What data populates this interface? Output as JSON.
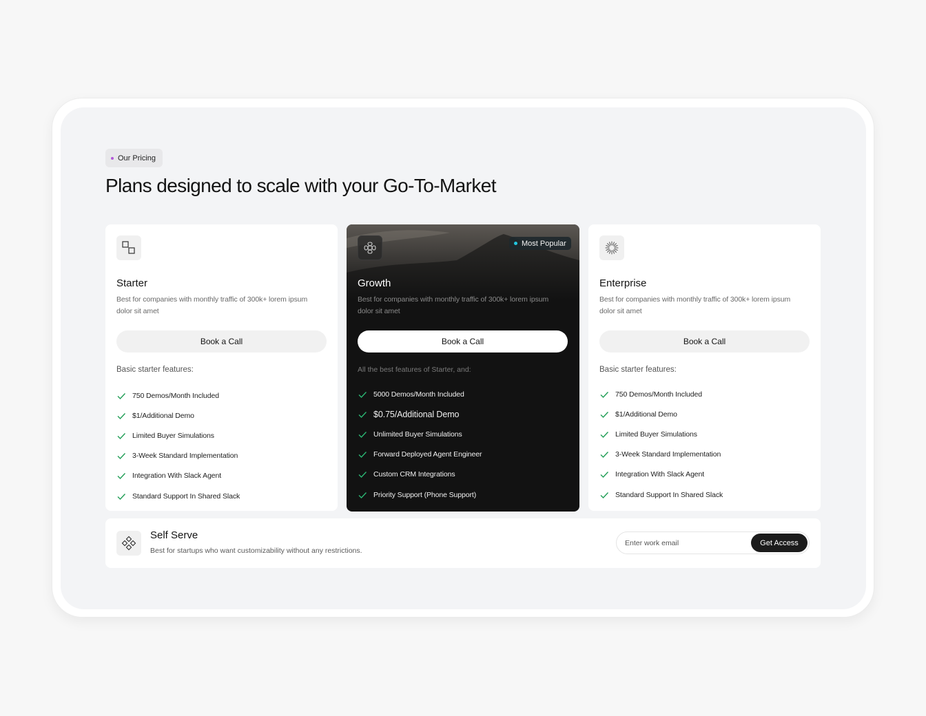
{
  "header": {
    "eyebrow": "Our Pricing",
    "title": "Plans designed to scale with your Go-To-Market"
  },
  "plans": [
    {
      "name": "Starter",
      "icon": "squares-icon",
      "description": "Best for companies with monthly traffic of 300k+ lorem ipsum dolor sit amet",
      "cta": "Book a Call",
      "features_heading": "Basic starter features:",
      "features": [
        "750 Demos/Month Included",
        "$1/Additional Demo",
        "Limited Buyer Simulations",
        "3-Week Standard Implementation",
        "Integration With Slack Agent",
        "Standard Support In Shared Slack"
      ]
    },
    {
      "name": "Growth",
      "icon": "flower-icon",
      "badge": "Most Popular",
      "description": "Best for companies with monthly traffic of 300k+ lorem ipsum dolor sit amet",
      "cta": "Book a Call",
      "features_heading": "All the best features of Starter, and:",
      "features": [
        "5000 Demos/Month Included",
        "$0.75/Additional Demo",
        "Unlimited Buyer Simulations",
        "Forward Deployed Agent Engineer",
        "Custom CRM Integrations",
        "Priority Support (Phone Support)"
      ]
    },
    {
      "name": "Enterprise",
      "icon": "sunburst-icon",
      "description": "Best for companies with monthly traffic of 300k+ lorem ipsum dolor sit amet",
      "cta": "Book a Call",
      "features_heading": "Basic starter features:",
      "features": [
        "750 Demos/Month Included",
        "$1/Additional Demo",
        "Limited Buyer Simulations",
        "3-Week Standard Implementation",
        "Integration With Slack Agent",
        "Standard Support In Shared Slack"
      ]
    }
  ],
  "self_serve": {
    "icon": "diamond-grid-icon",
    "name": "Self Serve",
    "description": "Best for startups who want customizability without any restrictions.",
    "email_placeholder": "Enter work email",
    "cta": "Get Access"
  },
  "colors": {
    "accent_dot": "#b35ad9",
    "badge_dot": "#22c7e0",
    "check": "#1f9d55",
    "dark_card": "#121212"
  }
}
